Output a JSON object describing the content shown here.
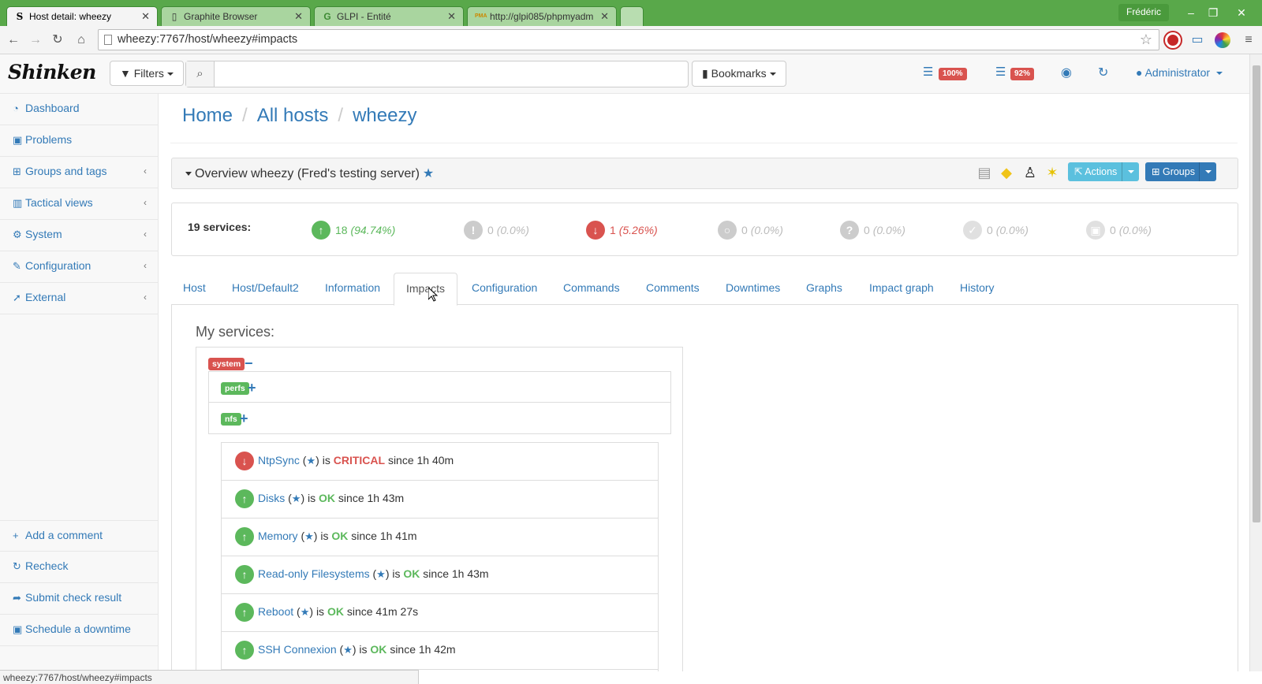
{
  "browser": {
    "tabs": [
      {
        "title": "Host detail: wheezy",
        "favicon": "S",
        "active": true
      },
      {
        "title": "Graphite Browser",
        "favicon": "doc-icon",
        "active": false
      },
      {
        "title": "GLPI - Entité",
        "favicon": "G",
        "active": false
      },
      {
        "title": "http://glpi085/phpmyadm",
        "favicon": "PMA",
        "active": false
      }
    ],
    "user": "Frédéric",
    "url": "wheezy:7767/host/wheezy#impacts",
    "status_url": "wheezy:7767/host/wheezy#impacts",
    "accent": "#59a84a"
  },
  "topnav": {
    "logo": "Shinken",
    "filters_label": "Filters",
    "search_placeholder": "",
    "bookmarks_label": "Bookmarks",
    "badge1": "100%",
    "badge2": "92%",
    "user_label": "Administrator"
  },
  "sidebar": {
    "items": [
      {
        "label": "Dashboard",
        "icon": "dashboard-icon"
      },
      {
        "label": "Problems",
        "icon": "ambulance-icon"
      },
      {
        "label": "Groups and tags",
        "icon": "sitemap-icon"
      },
      {
        "label": "Tactical views",
        "icon": "bar-chart-icon"
      },
      {
        "label": "System",
        "icon": "gears-icon"
      },
      {
        "label": "Configuration",
        "icon": "wrench-icon"
      },
      {
        "label": "External",
        "icon": "rocket-icon"
      }
    ],
    "actions": [
      {
        "label": "Add a comment",
        "icon": "plus-icon"
      },
      {
        "label": "Recheck",
        "icon": "refresh-icon"
      },
      {
        "label": "Submit check result",
        "icon": "share-icon"
      },
      {
        "label": "Schedule a downtime",
        "icon": "ambulance-icon"
      }
    ]
  },
  "breadcrumb": [
    "Home",
    "All hosts",
    "wheezy"
  ],
  "overview": {
    "title": "Overview wheezy (Fred's testing server)",
    "actions_label": "Actions",
    "groups_label": "Groups"
  },
  "summary": {
    "count_label": "19 services:",
    "stats": [
      {
        "state": "ok",
        "count": "18",
        "pct": "(94.74%)",
        "color": "#5cb85c"
      },
      {
        "state": "warning",
        "count": "0",
        "pct": "(0.0%)",
        "color": "#cccccc"
      },
      {
        "state": "critical",
        "count": "1",
        "pct": "(5.26%)",
        "color": "#d9534f"
      },
      {
        "state": "pending",
        "count": "0",
        "pct": "(0.0%)",
        "color": "#cccccc"
      },
      {
        "state": "unknown",
        "count": "0",
        "pct": "(0.0%)",
        "color": "#cccccc"
      },
      {
        "state": "ack",
        "count": "0",
        "pct": "(0.0%)",
        "color": "#e0e0e0"
      },
      {
        "state": "downtime",
        "count": "0",
        "pct": "(0.0%)",
        "color": "#e0e0e0"
      }
    ]
  },
  "tabs": [
    {
      "label": "Host",
      "active": false
    },
    {
      "label": "Host/Default2",
      "active": false
    },
    {
      "label": "Information",
      "active": false
    },
    {
      "label": "Impacts",
      "active": true
    },
    {
      "label": "Configuration",
      "active": false
    },
    {
      "label": "Commands",
      "active": false
    },
    {
      "label": "Comments",
      "active": false
    },
    {
      "label": "Downtimes",
      "active": false
    },
    {
      "label": "Graphs",
      "active": false
    },
    {
      "label": "Impact graph",
      "active": false
    },
    {
      "label": "History",
      "active": false
    }
  ],
  "impacts": {
    "heading": "My services:",
    "root_tag": "system",
    "groups": [
      "perfs",
      "nfs"
    ],
    "services": [
      {
        "name": "NtpSync",
        "state": "CRITICAL",
        "since": "since 1h 40m"
      },
      {
        "name": "Disks",
        "state": "OK",
        "since": "since 1h 43m"
      },
      {
        "name": "Memory",
        "state": "OK",
        "since": "since 1h 41m"
      },
      {
        "name": "Read-only Filesystems",
        "state": "OK",
        "since": "since 1h 43m"
      },
      {
        "name": "Reboot",
        "state": "OK",
        "since": "since 41m 27s"
      },
      {
        "name": "SSH Connexion",
        "state": "OK",
        "since": "since 1h 42m"
      }
    ]
  },
  "text": {
    "is": "is",
    "star": "★"
  }
}
